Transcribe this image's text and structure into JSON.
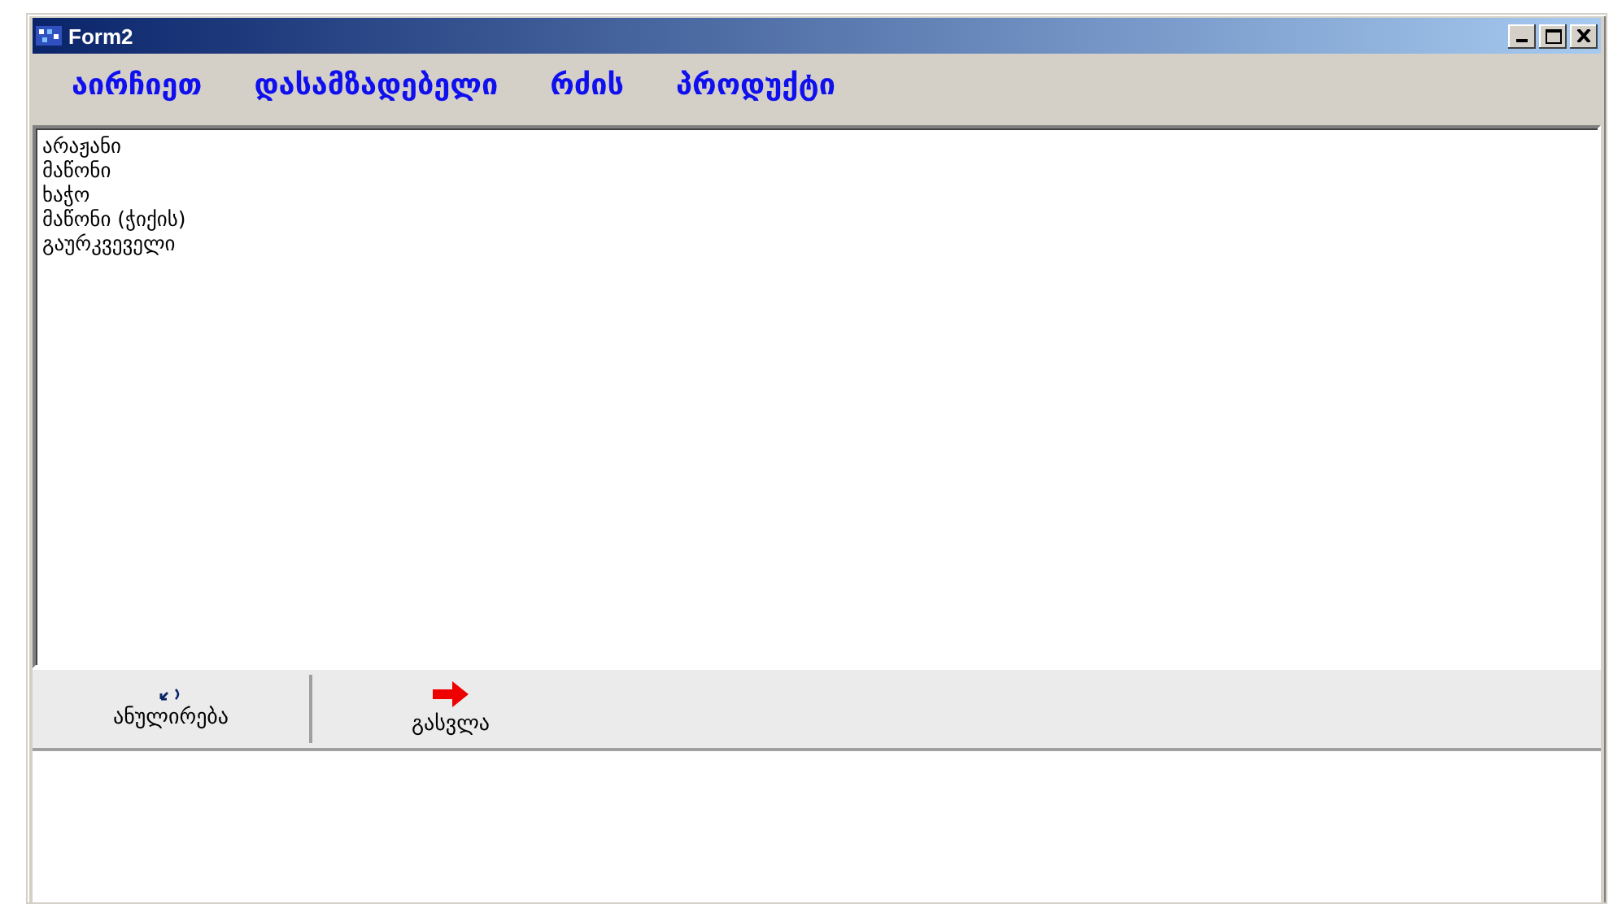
{
  "window": {
    "title": "Form2"
  },
  "heading": [
    "აირჩიეთ",
    "დასამზადებელი",
    "რძის",
    "პროდუქტი"
  ],
  "list": {
    "items": [
      {
        "label": "არაჟანი"
      },
      {
        "label": "მაწონი"
      },
      {
        "label": "ხაჭო"
      },
      {
        "label": "მაწონი (ჭიქის)"
      },
      {
        "label": "გაურკვეველი"
      }
    ]
  },
  "toolbar": [
    {
      "kind": "undo",
      "label": "ანულირება"
    },
    {
      "kind": "exit",
      "label": "გასვლა"
    }
  ]
}
